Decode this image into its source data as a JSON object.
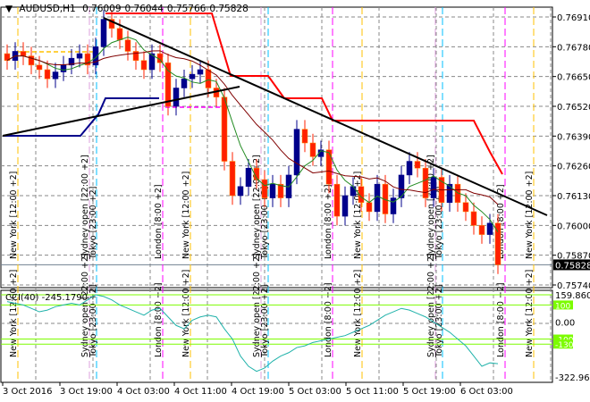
{
  "header": {
    "symbol_timeframe": "AUDUSD,H1",
    "open": "0.76009",
    "high": "0.76044",
    "low": "0.75766",
    "close": "0.75828"
  },
  "price_axis": {
    "ticks": [
      "0.76910",
      "0.76780",
      "0.76650",
      "0.76520",
      "0.76390",
      "0.76260",
      "0.76130",
      "0.76000",
      "0.75870",
      "0.75740"
    ],
    "current_price": "0.75828"
  },
  "indicator": {
    "label": "CCI(40) -245.1790",
    "max_label": "159.8601",
    "min_label": "-322.9653",
    "zero_label": "0.00",
    "levels": [
      "100",
      "-100",
      "-130"
    ]
  },
  "time_axis": [
    "3 Oct 2016",
    "3 Oct 19:00",
    "4 Oct 03:00",
    "4 Oct 11:00",
    "4 Oct 19:00",
    "5 Oct 03:00",
    "5 Oct 11:00",
    "5 Oct 19:00",
    "6 Oct 03:00"
  ],
  "sessions": [
    {
      "type": "ny",
      "label": "New York  [12:00 +2]"
    },
    {
      "type": "sydney",
      "label": "Sydney open  [22:00 +2]",
      "label2": "Tokyo  [23:00 +2]"
    },
    {
      "type": "london",
      "label": "London  [8:00 +2]"
    },
    {
      "type": "ny",
      "label": "New York  [12:00 +2]"
    },
    {
      "type": "sydney",
      "label": "Sydney open  [22:00 +2]",
      "label2": "Tokyo  [23:00 +2]"
    },
    {
      "type": "london",
      "label": "London  [8:00 +2]"
    },
    {
      "type": "ny",
      "label": "New York  [12:00 +2]"
    },
    {
      "type": "sydney",
      "label": "Sydney open  [22:00 +2]",
      "label2": "Tokyo  [23:00 +2]"
    },
    {
      "type": "london",
      "label": "London  [8:00 +2]"
    },
    {
      "type": "ny",
      "label": "New York  [12:00 +2]"
    }
  ],
  "colors": {
    "bull": "#00008b",
    "bear": "#ff2000",
    "ma_fast": "#228b22",
    "ma_slow": "#800000",
    "stop": "#ff0000",
    "cci": "#20b2aa",
    "level": "#7cfc00",
    "ny": "#ffc000",
    "london": "#ff00ff",
    "sydney": "#dda0dd",
    "tokyo": "#00bfff"
  },
  "chart_data": {
    "type": "candlestick",
    "ylim": [
      0.7574,
      0.7691
    ],
    "closes": [
      0.7672,
      0.7676,
      0.7674,
      0.767,
      0.7668,
      0.7664,
      0.7667,
      0.767,
      0.7673,
      0.7675,
      0.767,
      0.7678,
      0.769,
      0.7686,
      0.7681,
      0.7676,
      0.7672,
      0.7668,
      0.7675,
      0.7671,
      0.7652,
      0.766,
      0.7664,
      0.7666,
      0.7668,
      0.766,
      0.7656,
      0.7628,
      0.7613,
      0.7617,
      0.7625,
      0.762,
      0.7612,
      0.7618,
      0.7612,
      0.7622,
      0.7642,
      0.7636,
      0.763,
      0.7633,
      0.7618,
      0.7604,
      0.7613,
      0.7617,
      0.761,
      0.7606,
      0.7618,
      0.7605,
      0.7612,
      0.7622,
      0.7628,
      0.7625,
      0.7612,
      0.7621,
      0.761,
      0.7618,
      0.761,
      0.7606,
      0.76,
      0.7596,
      0.7601,
      0.75828
    ],
    "cci": [
      120,
      110,
      100,
      80,
      60,
      70,
      90,
      100,
      110,
      100,
      130,
      160,
      150,
      130,
      100,
      80,
      60,
      40,
      70,
      80,
      30,
      -20,
      -40,
      10,
      30,
      40,
      30,
      -40,
      -100,
      -200,
      -260,
      -290,
      -270,
      -230,
      -200,
      -180,
      -150,
      -140,
      -120,
      -110,
      -100,
      -90,
      -80,
      -60,
      -40,
      -20,
      10,
      40,
      60,
      80,
      70,
      50,
      30,
      0,
      -30,
      -60,
      -100,
      -140,
      -200,
      -260,
      -240,
      -245
    ]
  }
}
